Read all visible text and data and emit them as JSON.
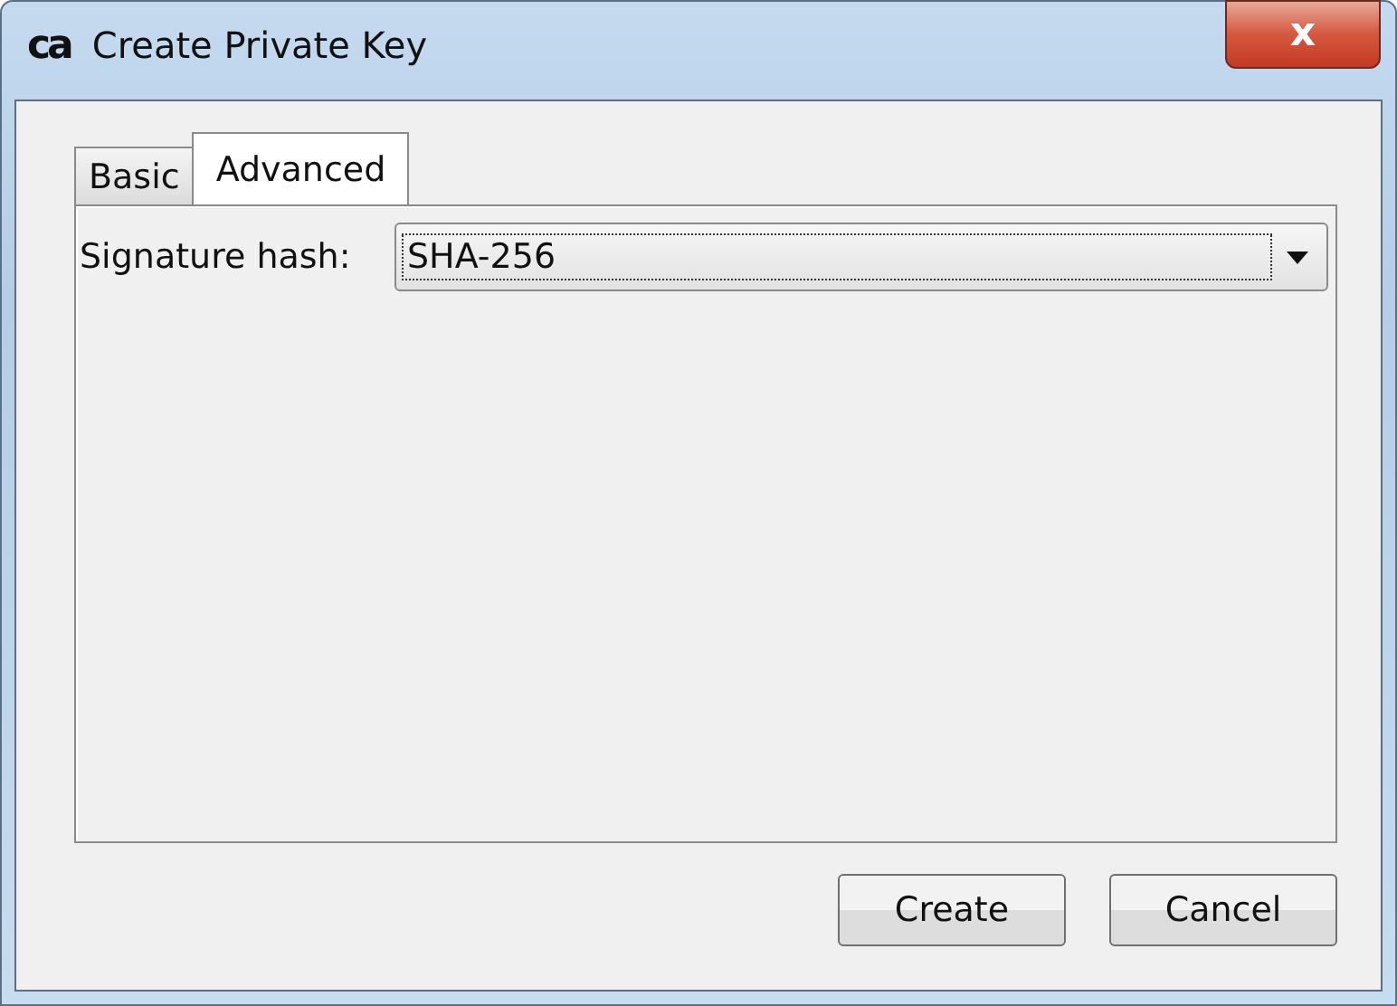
{
  "window": {
    "logo": "ca",
    "title": "Create Private Key",
    "close": "x"
  },
  "tabs": [
    {
      "label": "Basic",
      "selected": false
    },
    {
      "label": "Advanced",
      "selected": true
    }
  ],
  "fields": [
    {
      "label": "Signature hash:",
      "value": "SHA-256",
      "focused": true
    }
  ],
  "buttons": [
    "Create",
    "Cancel"
  ]
}
